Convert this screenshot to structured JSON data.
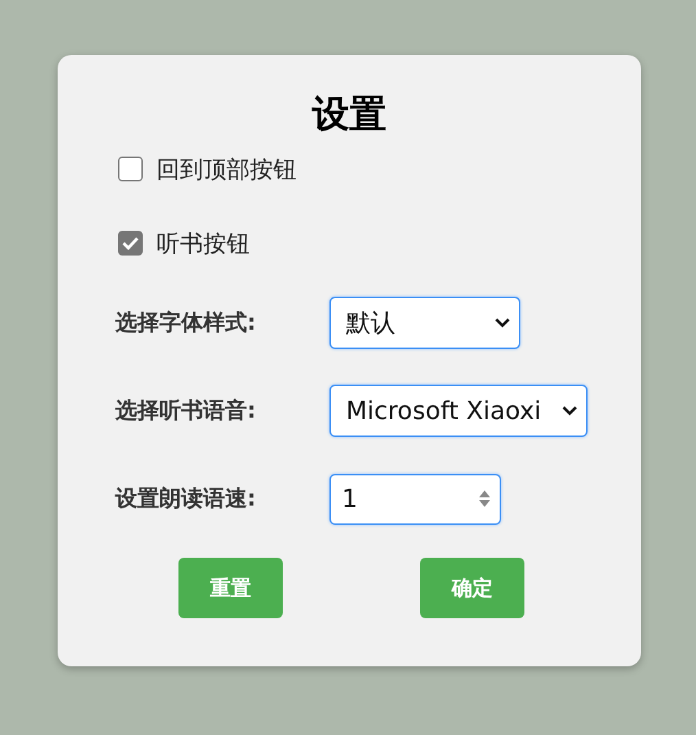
{
  "dialog": {
    "title": "设置",
    "checkboxes": [
      {
        "label": "回到顶部按钮",
        "checked": false
      },
      {
        "label": "听书按钮",
        "checked": true
      }
    ],
    "fields": [
      {
        "kind": "select",
        "label": "选择字体样式:",
        "value": "默认"
      },
      {
        "kind": "select",
        "label": "选择听书语音:",
        "value": "Microsoft Xiaoxi"
      },
      {
        "kind": "number",
        "label": "设置朗读语速:",
        "value": "1"
      }
    ],
    "buttons": [
      "重置",
      "确定"
    ]
  }
}
